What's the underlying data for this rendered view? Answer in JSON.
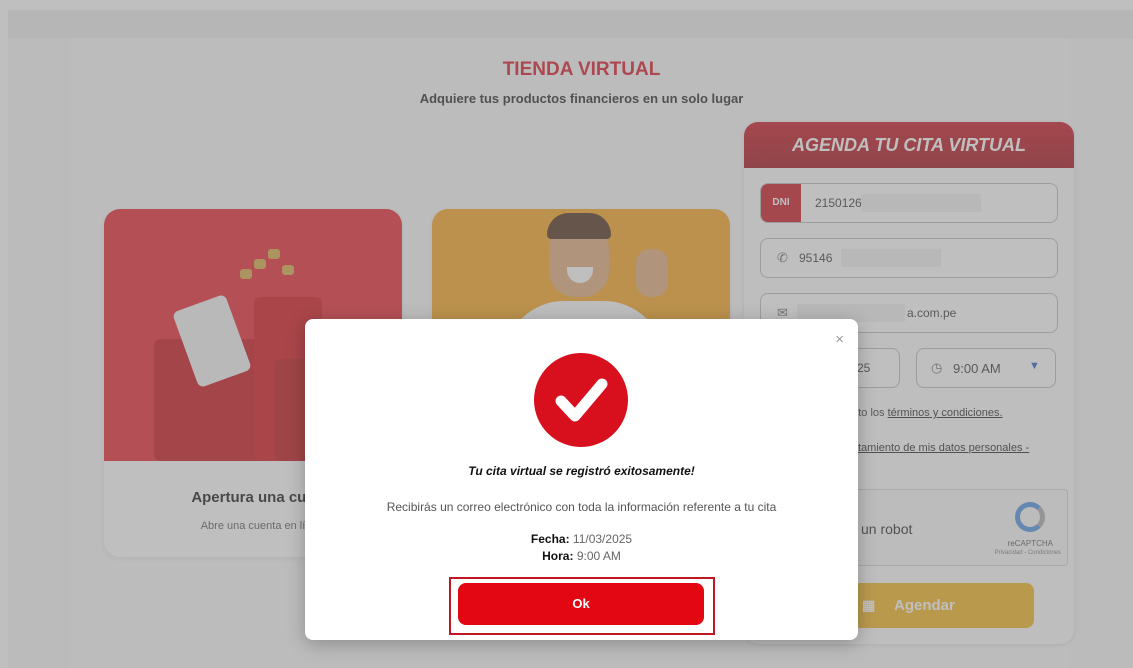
{
  "hero": {
    "title": "TIENDA VIRTUAL",
    "subtitle": "Adquiere tus productos financieros en un solo lugar"
  },
  "cards": [
    {
      "title": "Apertura una cue",
      "description": "Abre una cuenta en lí"
    },
    {
      "title": "",
      "description": ""
    }
  ],
  "agenda": {
    "header": "AGENDA TU CITA VIRTUAL",
    "dni_tag": "DNI",
    "dni_value": "2150126",
    "phone_value": "95146",
    "email_value": "a.com.pe",
    "date_value": "25",
    "time_value": "9:00 AM",
    "terms_prefix": "epto los ",
    "terms_link": "términos y condiciones.",
    "data_link": "tamiento de mis datos personales -",
    "captcha_label": "un robot",
    "captcha_brand": "reCAPTCHA",
    "captcha_privacy": "Privacidad - Condiciones",
    "submit_label": "Agendar"
  },
  "modal": {
    "close_glyph": "×",
    "title": "Tu cita virtual se registró exitosamente!",
    "message": "Recibirás un correo electrónico con toda la información referente a tu cita",
    "fecha_label": "Fecha:",
    "fecha_value": "11/03/2025",
    "hora_label": "Hora:",
    "hora_value": "9:00 AM",
    "ok_label": "Ok"
  },
  "colors": {
    "brand_red": "#e30613",
    "accent_yellow": "#f2b51a"
  },
  "icons": [
    "phone-icon",
    "mail-icon",
    "clock-icon",
    "chevron-down-icon",
    "calendar-icon",
    "close-icon",
    "check-icon"
  ]
}
